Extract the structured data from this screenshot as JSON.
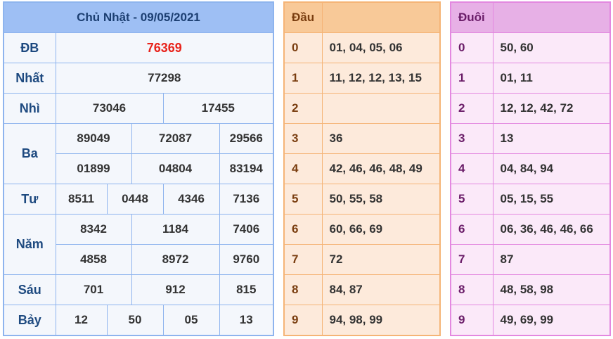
{
  "results": {
    "title": "Chủ Nhật - 09/05/2021",
    "db": {
      "label": "ĐB",
      "values": [
        "76369"
      ]
    },
    "nhat": {
      "label": "Nhất",
      "values": [
        "77298"
      ]
    },
    "nhi": {
      "label": "Nhì",
      "values": [
        "73046",
        "17455"
      ]
    },
    "ba": {
      "label": "Ba",
      "values": [
        "89049",
        "72087",
        "29566",
        "01899",
        "04804",
        "83194"
      ]
    },
    "tu": {
      "label": "Tư",
      "values": [
        "8511",
        "0448",
        "4346",
        "7136"
      ]
    },
    "nam": {
      "label": "Năm",
      "values": [
        "8342",
        "1184",
        "7406",
        "4858",
        "8972",
        "9760"
      ]
    },
    "sau": {
      "label": "Sáu",
      "values": [
        "701",
        "912",
        "815"
      ]
    },
    "bay": {
      "label": "Bảy",
      "values": [
        "12",
        "50",
        "05",
        "13"
      ]
    },
    "special_color": "#e8241c"
  },
  "dau": {
    "header": "Đầu",
    "rows": [
      {
        "k": "0",
        "v": "01, 04, 05, 06"
      },
      {
        "k": "1",
        "v": "11, 12, 12, 13, 15"
      },
      {
        "k": "2",
        "v": ""
      },
      {
        "k": "3",
        "v": "36"
      },
      {
        "k": "4",
        "v": "42, 46, 46, 48, 49"
      },
      {
        "k": "5",
        "v": "50, 55, 58"
      },
      {
        "k": "6",
        "v": "60, 66, 69"
      },
      {
        "k": "7",
        "v": "72"
      },
      {
        "k": "8",
        "v": "84, 87"
      },
      {
        "k": "9",
        "v": "94, 98, 99"
      }
    ]
  },
  "duoi": {
    "header": "Đuôi",
    "rows": [
      {
        "k": "0",
        "v": "50, 60"
      },
      {
        "k": "1",
        "v": "01, 11"
      },
      {
        "k": "2",
        "v": "12, 12, 42, 72"
      },
      {
        "k": "3",
        "v": "13"
      },
      {
        "k": "4",
        "v": "04, 84, 94"
      },
      {
        "k": "5",
        "v": "05, 15, 55"
      },
      {
        "k": "6",
        "v": "06, 36, 46, 46, 66"
      },
      {
        "k": "7",
        "v": "87"
      },
      {
        "k": "8",
        "v": "48, 58, 98"
      },
      {
        "k": "9",
        "v": "49, 69, 99"
      }
    ]
  }
}
